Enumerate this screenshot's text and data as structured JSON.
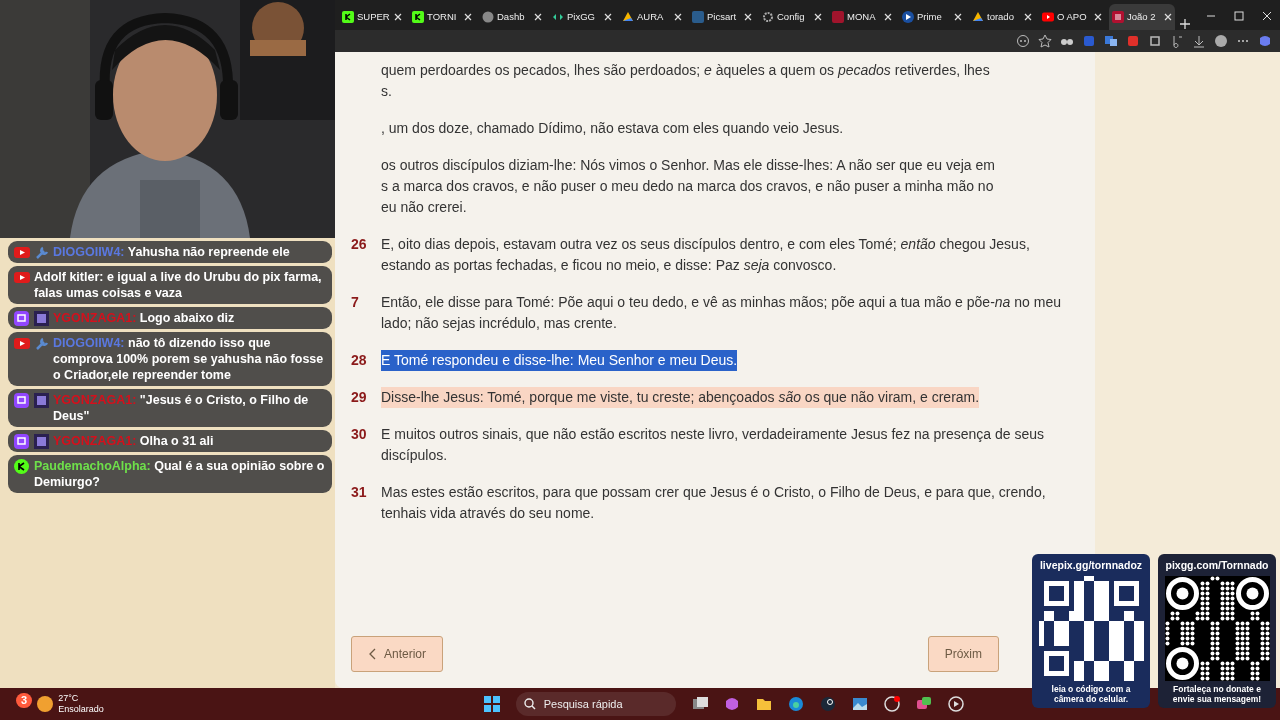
{
  "browser": {
    "tabs": [
      {
        "label": "SUPER",
        "kind": "kick",
        "selected": false
      },
      {
        "label": "TORNI",
        "kind": "kick",
        "selected": false
      },
      {
        "label": "Dashb",
        "kind": "disc",
        "selected": false
      },
      {
        "label": "PixGG",
        "kind": "pixgg",
        "selected": false
      },
      {
        "label": "AURA",
        "kind": "drive",
        "selected": false
      },
      {
        "label": "Picsart",
        "kind": "picsart",
        "selected": false
      },
      {
        "label": "Config",
        "kind": "gear",
        "selected": false
      },
      {
        "label": "MONA",
        "kind": "red",
        "selected": false
      },
      {
        "label": "Prime",
        "kind": "prime",
        "selected": false
      },
      {
        "label": "torado",
        "kind": "drive",
        "selected": false
      },
      {
        "label": "O APO",
        "kind": "youtube",
        "selected": false
      },
      {
        "label": "João 2",
        "kind": "bible",
        "selected": true
      }
    ]
  },
  "chat": [
    {
      "kind": "youtube_mod",
      "user": "DIOGOIIW4:",
      "color": "#5a78e0",
      "text": "Yahusha não repreende ele"
    },
    {
      "kind": "youtube",
      "user": "Adolf kitler:",
      "color": "#ffffff",
      "text": "e igual a live do Urubu do pix farma, falas umas coisas e vaza"
    },
    {
      "kind": "twitch_sub",
      "user": "YGONZAGA1:",
      "color": "#d4101c",
      "text": "Logo abaixo diz"
    },
    {
      "kind": "youtube_mod",
      "user": "DIOGOIIW4:",
      "color": "#5a78e0",
      "text": "não tô dizendo isso que comprova 100% porem se yahusha não fosse o Criador,ele repreender tome"
    },
    {
      "kind": "twitch_sub",
      "user": "YGONZAGA1:",
      "color": "#d4101c",
      "text": "\"Jesus é o Cristo, o Filho de Deus\""
    },
    {
      "kind": "twitch_sub",
      "user": "YGONZAGA1:",
      "color": "#d4101c",
      "text": "Olha o 31 ali"
    },
    {
      "kind": "kick",
      "user": "PaudemachoAlpha:",
      "color": "#6ee04a",
      "text": "Qual é a sua opinião sobre o Demiurgo?"
    }
  ],
  "verses": [
    {
      "selected": false,
      "highlighted": false,
      "lines": [
        "quem perdoardes os pecados, lhes são perdoados; *e* àqueles a quem os *pecados* retiverdes, lhes",
        "s."
      ]
    },
    {
      "selected": false,
      "highlighted": false,
      "lines": [
        ", um dos doze, chamado Dídimo, não estava com eles quando veio Jesus."
      ]
    },
    {
      "selected": false,
      "highlighted": false,
      "lines": [
        "os outros discípulos diziam-lhe: Nós vimos o Senhor. Mas ele disse-lhes: A não ser que eu veja em",
        "s a marca dos cravos, e não puser o meu dedo na marca dos cravos, e não puser a minha mão no",
        "eu não crerei."
      ]
    },
    {
      "number": "26",
      "selected": false,
      "highlighted": false,
      "lines": [
        "E, oito dias depois, estavam outra vez os seus discípulos dentro, e com eles Tomé; *então* chegou Jesus,",
        "estando as portas fechadas, e ficou no meio, e disse: Paz *seja* convosco."
      ]
    },
    {
      "number": "7",
      "selected": false,
      "highlighted": false,
      "lines": [
        "Então, ele disse para Tomé: Põe aqui o teu dedo, e vê as minhas mãos; põe aqui a tua mão e põe-*na* no meu",
        "lado; não sejas incrédulo, mas crente."
      ]
    },
    {
      "number": "28",
      "selected": true,
      "highlighted": false,
      "lines": [
        "E Tomé respondeu e disse-lhe: Meu Senhor e meu Deus."
      ]
    },
    {
      "number": "29",
      "selected": false,
      "highlighted": true,
      "lines": [
        "Disse-lhe Jesus: Tomé, porque me viste, tu creste; abençoados *são* os que não viram, e creram."
      ]
    },
    {
      "number": "30",
      "selected": false,
      "highlighted": false,
      "lines": [
        "E muitos outros sinais, que não estão escritos neste livro, verdadeiramente Jesus fez na presença de seus",
        "discípulos."
      ]
    },
    {
      "number": "31",
      "selected": false,
      "highlighted": false,
      "lines": [
        "Mas estes estão escritos, para que possam crer que Jesus é o Cristo, o Filho de Deus, e para que, crendo,",
        "tenhais vida através do seu nome."
      ]
    }
  ],
  "nav": {
    "previous": "Anterior",
    "next": "Próxim"
  },
  "qr_cards": [
    {
      "kind": "light",
      "title": "livepix.gg/tornnadoz",
      "caption": "leia o código com a câmera do celular."
    },
    {
      "kind": "dark",
      "title": "pixgg.com/Tornnado",
      "caption": "Fortaleça no donate e envie sua mensagem!"
    }
  ],
  "taskbar": {
    "weather_badge": "3",
    "temperature": "27°C",
    "condition": "Ensolarado",
    "search_placeholder": "Pesquisa rápida"
  }
}
